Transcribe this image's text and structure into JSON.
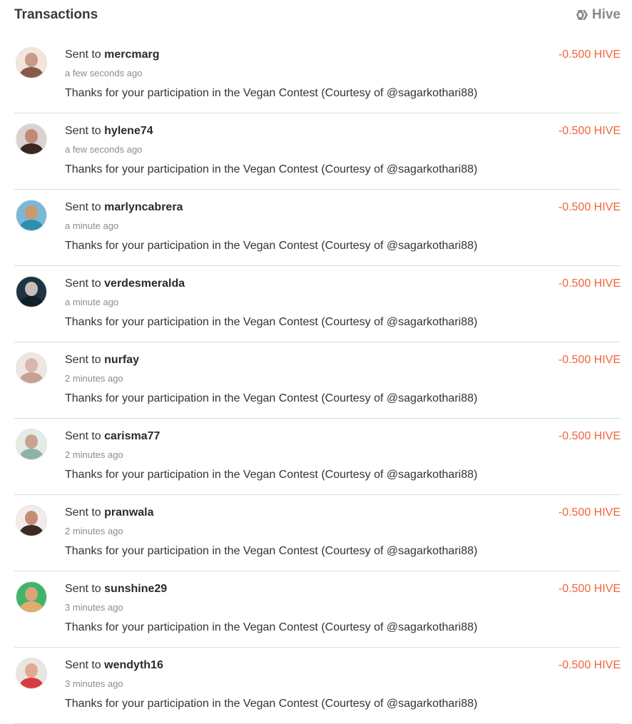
{
  "header": {
    "title": "Transactions",
    "chain_label": "Hive",
    "chain_icon": "hive-logo-icon"
  },
  "colors": {
    "amount": "#f0643c",
    "secondary_text": "#8c8c8c",
    "divider": "#dcdcdc"
  },
  "transactions": [
    {
      "prefix": "Sent to",
      "user": "mercmarg",
      "time": "a few seconds ago",
      "memo": "Thanks for your participation in the Vegan Contest (Courtesy of @sagarkothari88)",
      "amount": "-0.500 HIVE",
      "avatar_colors": [
        "#f3e4dc",
        "#c99a84",
        "#8a5a48"
      ]
    },
    {
      "prefix": "Sent to",
      "user": "hylene74",
      "time": "a few seconds ago",
      "memo": "Thanks for your participation in the Vegan Contest (Courtesy of @sagarkothari88)",
      "amount": "-0.500 HIVE",
      "avatar_colors": [
        "#d9d2cf",
        "#c08a78",
        "#3a2622"
      ]
    },
    {
      "prefix": "Sent to",
      "user": "marlyncabrera",
      "time": "a minute ago",
      "memo": "Thanks for your participation in the Vegan Contest (Courtesy of @sagarkothari88)",
      "amount": "-0.500 HIVE",
      "avatar_colors": [
        "#7ab8d9",
        "#c89a6c",
        "#2e8fb0"
      ]
    },
    {
      "prefix": "Sent to",
      "user": "verdesmeralda",
      "time": "a minute ago",
      "memo": "Thanks for your participation in the Vegan Contest (Courtesy of @sagarkothari88)",
      "amount": "-0.500 HIVE",
      "avatar_colors": [
        "#1f3340",
        "#c7bfb8",
        "#102028"
      ]
    },
    {
      "prefix": "Sent to",
      "user": "nurfay",
      "time": "2 minutes ago",
      "memo": "Thanks for your participation in the Vegan Contest (Courtesy of @sagarkothari88)",
      "amount": "-0.500 HIVE",
      "avatar_colors": [
        "#efe6e4",
        "#d8b7ae",
        "#c9a094"
      ]
    },
    {
      "prefix": "Sent to",
      "user": "carisma77",
      "time": "2 minutes ago",
      "memo": "Thanks for your participation in the Vegan Contest (Courtesy of @sagarkothari88)",
      "amount": "-0.500 HIVE",
      "avatar_colors": [
        "#e4ece8",
        "#c7a592",
        "#8fb2a8"
      ]
    },
    {
      "prefix": "Sent to",
      "user": "pranwala",
      "time": "2 minutes ago",
      "memo": "Thanks for your participation in the Vegan Contest (Courtesy of @sagarkothari88)",
      "amount": "-0.500 HIVE",
      "avatar_colors": [
        "#f2ece8",
        "#c48c76",
        "#3c2a24"
      ]
    },
    {
      "prefix": "Sent to",
      "user": "sunshine29",
      "time": "3 minutes ago",
      "memo": "Thanks for your participation in the Vegan Contest (Courtesy of @sagarkothari88)",
      "amount": "-0.500 HIVE",
      "avatar_colors": [
        "#3fb56a",
        "#d9a47a",
        "#e0ad6c"
      ]
    },
    {
      "prefix": "Sent to",
      "user": "wendyth16",
      "time": "3 minutes ago",
      "memo": "Thanks for your participation in the Vegan Contest (Courtesy of @sagarkothari88)",
      "amount": "-0.500 HIVE",
      "avatar_colors": [
        "#e9e6e2",
        "#e2a98e",
        "#d83a44"
      ]
    }
  ]
}
